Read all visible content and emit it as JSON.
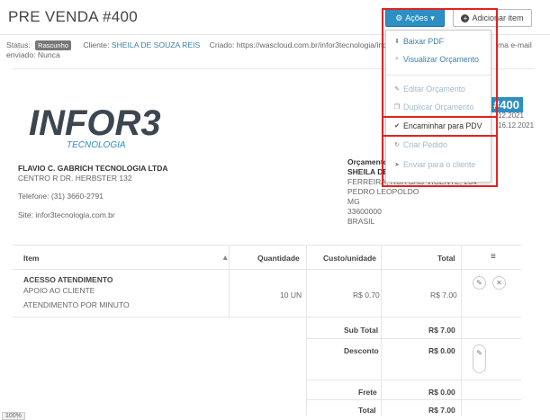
{
  "header": {
    "title": "PRE VENDA #400",
    "actions_label": "Ações",
    "add_item_label": "Adicionar item"
  },
  "meta": {
    "status_label": "Status:",
    "status_badge": "Rascunho",
    "cliente_label": "Cliente:",
    "cliente_value": "SHEILA DE SOUZA REIS",
    "criado_label": "Criado:",
    "criado_value": "https://wascloud.com.br/infor3tecnologia/ind",
    "enviado_label": "enviado: Nunca",
    "right_fragment": "ma e-mail"
  },
  "document": {
    "number": "#400",
    "date1": "12.2021",
    "date2": "16.12.2021",
    "logo_text": "INFOR3",
    "logo_sub": "TECNOLOGIA"
  },
  "company": {
    "name": "FLAVIO C. GABRICH TECNOLOGIA LTDA",
    "address": "CENTRO R DR. HERBSTER 132",
    "phone": "Telefone: (31) 3660-2791",
    "site": "Site: infor3tecnologia.com.br"
  },
  "client": {
    "heading": "Orçamento",
    "name": "SHEILA DE",
    "lines": [
      "FERREIRA, RUA SAO VICENTE, 234",
      "PEDRO LEOPOLDO",
      "MG",
      "33600000",
      "BRASIL"
    ]
  },
  "table": {
    "headers": {
      "item": "Item",
      "quantidade": "Quantidade",
      "custo": "Custo/unidade",
      "total": "Total"
    },
    "rows": [
      {
        "name": "ACESSO ATENDIMENTO",
        "desc1": "APOIO AO CLIENTE",
        "desc2": "ATENDIMENTO POR MINUTO",
        "qty": "10 UN",
        "unit": "R$ 0.70",
        "total": "R$ 7.00"
      }
    ],
    "summary": {
      "subtotal_label": "Sub Total",
      "subtotal_value": "R$ 7.00",
      "desconto_label": "Desconto",
      "desconto_value": "R$ 0.00",
      "frete_label": "Frete",
      "frete_value": "R$ 0.00",
      "total_label": "Total",
      "total_value": "R$ 7.00"
    }
  },
  "menu": {
    "items": [
      {
        "label": "Baixar PDF",
        "icon": "download-icon"
      },
      {
        "label": "Visualizar Orçamento",
        "icon": "search-icon"
      },
      {
        "label": "Editar Orçamento",
        "icon": "edit-icon"
      },
      {
        "label": "Duplicar Orçamento",
        "icon": "copy-icon"
      },
      {
        "label": "Encaminhar para PDV",
        "icon": "check-circle-icon"
      },
      {
        "label": "Criar Pedido",
        "icon": "refresh-icon"
      },
      {
        "label": "Enviar para o cliente",
        "icon": "send-icon"
      }
    ]
  },
  "footer": {
    "zoom": "100%"
  },
  "colors": {
    "accent": "#2d8fc4",
    "highlight_border": "#e32121"
  }
}
